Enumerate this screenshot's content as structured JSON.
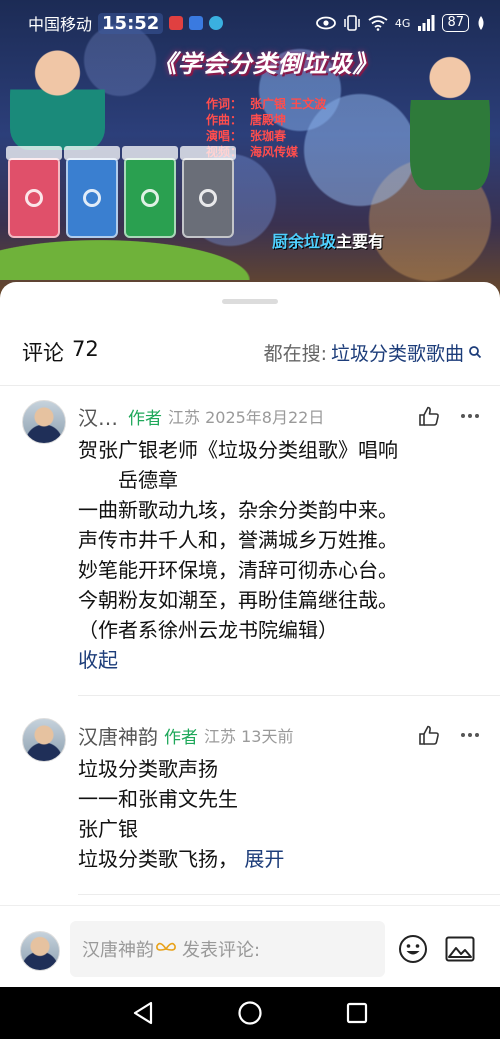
{
  "status_bar": {
    "carrier": "中国移动",
    "time": "15:52",
    "network": "4G",
    "battery": "87"
  },
  "video": {
    "title": "《学会分类倒垃圾》",
    "credits": [
      {
        "role": "作词：",
        "name": "张广银 王文波"
      },
      {
        "role": "作曲：",
        "name": "唐殿坤"
      },
      {
        "role": "演唱：",
        "name": "张珈春"
      },
      {
        "role": "视频：",
        "name": "海风传媒"
      }
    ],
    "lyric_highlight": "厨余垃圾",
    "lyric_rest": "主要有"
  },
  "comments_header": {
    "label": "评论",
    "count": "72",
    "search_label": "都在搜:",
    "search_term": "垃圾分类歌歌曲"
  },
  "comments": [
    {
      "user": "汉…",
      "tag": "作者",
      "meta": "江苏 2025年8月22日",
      "lines": [
        "贺张广银老师《垃圾分类组歌》唱响",
        "　　岳德章",
        "一曲新歌动九垓，杂余分类韵中来。",
        "声传市井千人和，誉满城乡万姓推。",
        "妙笔能开环保境，清辞可彻赤心台。",
        "今朝粉友如潮至，再盼佳篇继往哉。",
        "（作者系徐州云龙书院编辑）"
      ],
      "toggle": "收起"
    },
    {
      "user": "汉唐神韵",
      "tag": "作者",
      "meta": "江苏 13天前",
      "lines": [
        "垃圾分类歌声扬",
        "一一和张甫文先生",
        "张广银",
        "垃圾分类歌飞扬，"
      ],
      "toggle": "展开"
    }
  ],
  "input": {
    "username": "汉唐神韵",
    "placeholder": "发表评论:"
  },
  "colors": {
    "link": "#1d3d7a",
    "author_tag": "#1fa85a",
    "meta": "#9a9a9a"
  }
}
